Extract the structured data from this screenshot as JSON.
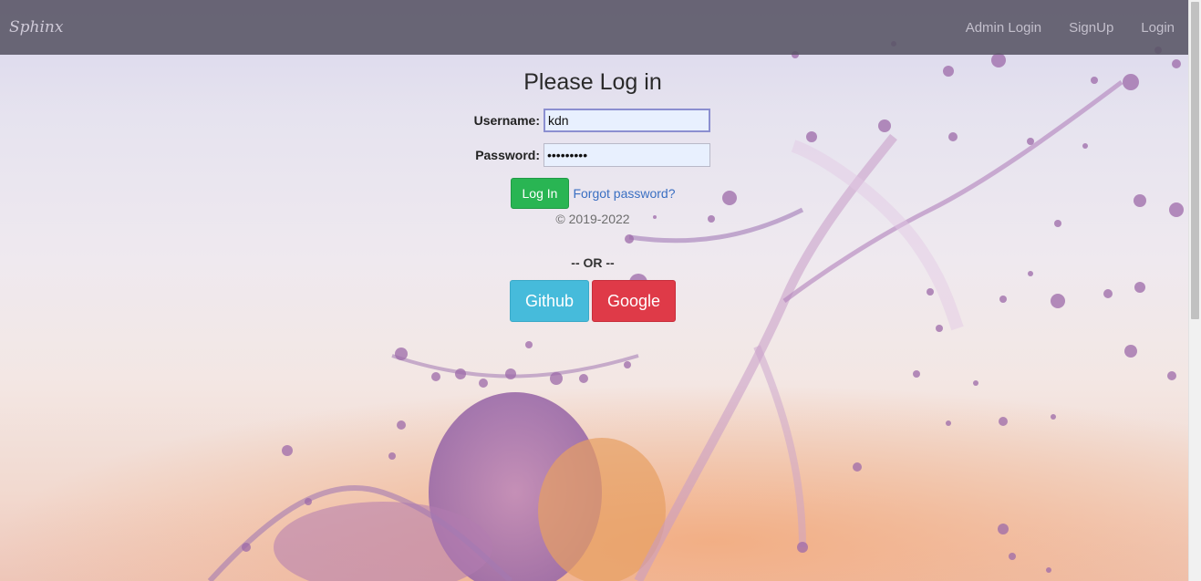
{
  "navbar": {
    "brand": "Sphinx",
    "links": [
      "Admin Login",
      "SignUp",
      "Login"
    ]
  },
  "login": {
    "title": "Please Log in",
    "username_label": "Username:",
    "username_value": "kdn",
    "password_label": "Password:",
    "password_value": "•••••••••",
    "login_button": "Log In",
    "forgot_link": "Forgot password?",
    "copyright": "© 2019-2022",
    "or_text": "-- OR --",
    "oauth": {
      "github": "Github",
      "google": "Google"
    }
  },
  "colors": {
    "navbar_bg": "#585464",
    "login_button": "#29b553",
    "github_button": "#46bbdb",
    "google_button": "#df3a48",
    "link": "#3a6fc2"
  }
}
